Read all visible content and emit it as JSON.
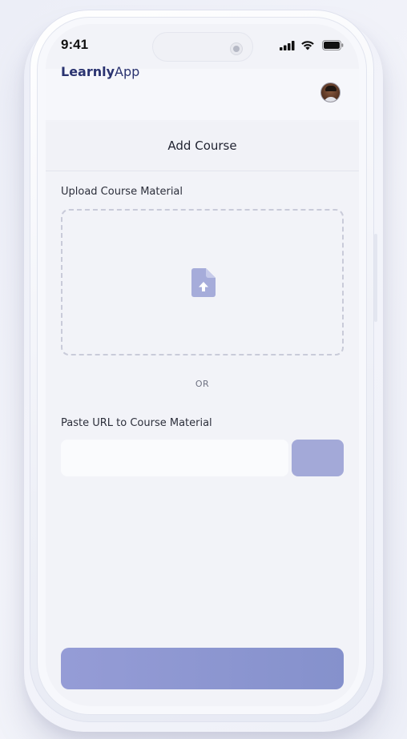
{
  "status_bar": {
    "time": "9:41",
    "icons": [
      "signal-icon",
      "wifi-icon",
      "battery-icon"
    ]
  },
  "header": {
    "logo_part1": "Learnly",
    "logo_part2": "App",
    "avatar": "user-avatar"
  },
  "page": {
    "title": "Add Course"
  },
  "upload": {
    "label": "Upload Course Material",
    "icon": "file-upload-icon"
  },
  "divider": {
    "text": "OR"
  },
  "url": {
    "label": "Paste URL to Course Material",
    "value": "",
    "placeholder": "",
    "submit_label": ""
  },
  "footer": {
    "primary_label": ""
  },
  "colors": {
    "accent": "#a3a9d8",
    "primary": "#8c95d0",
    "brand": "#2a3370",
    "icon": "#a6acda"
  }
}
